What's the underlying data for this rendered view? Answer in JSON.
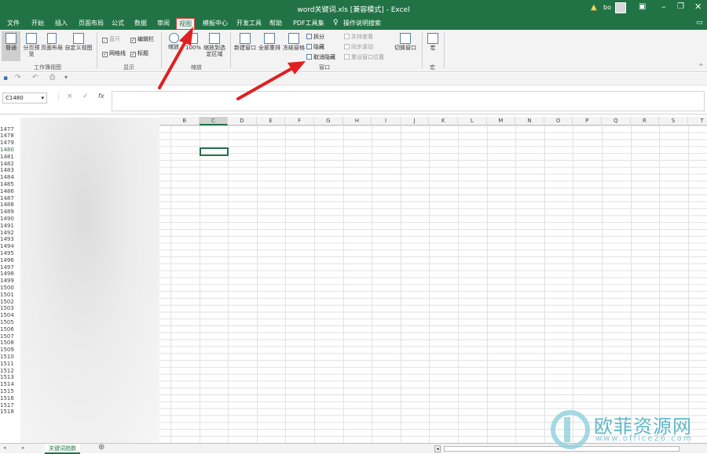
{
  "window": {
    "title": "word关键词.xls  [兼容模式]  -  Excel",
    "user": "bo",
    "warning_icon": "warning-icon",
    "controls": [
      "ribbon-display-icon",
      "minimize-icon",
      "restore-icon",
      "close-icon"
    ]
  },
  "tabs": [
    {
      "label": "文件"
    },
    {
      "label": "开始"
    },
    {
      "label": "插入"
    },
    {
      "label": "页面布局"
    },
    {
      "label": "公式"
    },
    {
      "label": "数据"
    },
    {
      "label": "审阅"
    },
    {
      "label": "视图",
      "active": true
    },
    {
      "label": "模板中心"
    },
    {
      "label": "开发工具"
    },
    {
      "label": "帮助"
    },
    {
      "label": "PDF工具集"
    }
  ],
  "tell_me": "操作说明搜索",
  "ribbon": {
    "workbook_views": {
      "normal": "普通",
      "page_break": "分页预览",
      "page_layout": "页面布局",
      "custom_views": "自定义视图",
      "group": "工作簿视图"
    },
    "show": {
      "ruler": "直尺",
      "formula_bar": "编辑栏",
      "gridlines": "网格线",
      "headings": "标题",
      "group": "显示"
    },
    "zoom": {
      "zoom": "缩放",
      "hundred": "100%",
      "to_selection": "缩放到选定区域",
      "group": "缩放"
    },
    "window": {
      "new_window": "新建窗口",
      "arrange_all": "全部重排",
      "freeze_panes": "冻结窗格",
      "split": "拆分",
      "hide": "隐藏",
      "unhide": "取消隐藏",
      "side_by_side": "并排查看",
      "sync_scroll": "同步滚动",
      "reset_position": "重设窗口位置",
      "switch_windows": "切换窗口",
      "group": "窗口"
    },
    "macros": {
      "macros": "宏",
      "group": "宏"
    }
  },
  "formula_bar": {
    "name_box": "C1480",
    "cancel": "×",
    "enter": "✓",
    "fx": "fx"
  },
  "columns": [
    "B",
    "C",
    "D",
    "E",
    "F",
    "G",
    "H",
    "I",
    "J",
    "K",
    "L",
    "M",
    "N",
    "O",
    "P",
    "Q",
    "R",
    "S",
    "T"
  ],
  "selected_column": "C",
  "rows": [
    "1477",
    "1478",
    "1479",
    "1480",
    "1481",
    "1482",
    "1483",
    "1484",
    "1485",
    "1486",
    "1487",
    "1488",
    "1489",
    "1490",
    "1491",
    "1492",
    "1493",
    "1494",
    "1495",
    "1496",
    "1497",
    "1498",
    "1499",
    "1500",
    "1501",
    "1502",
    "1503",
    "1504",
    "1505",
    "1506",
    "1507",
    "1508",
    "1509",
    "1510",
    "1511",
    "1512",
    "1513",
    "1514",
    "1515",
    "1516",
    "1517",
    "1518"
  ],
  "selected_row": "1480",
  "sheet_tab": "关键词指数",
  "watermark": {
    "text": "欧菲资源网",
    "url": "www.office26.com"
  }
}
